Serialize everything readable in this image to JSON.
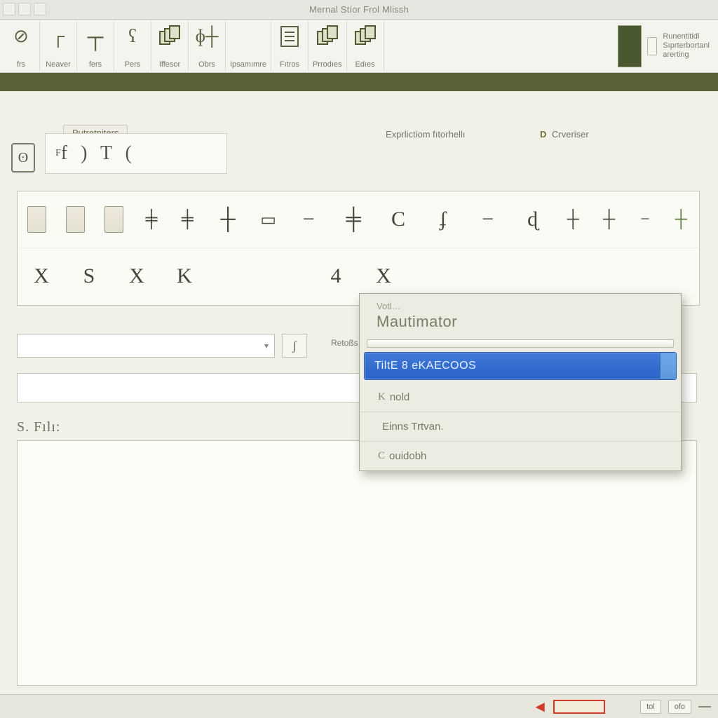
{
  "window": {
    "title": "Mernal Stíor Frol Mlissh"
  },
  "qat": [
    "qat-1",
    "qat-2",
    "qat-3"
  ],
  "ribbon": {
    "groups": [
      {
        "id": "frs",
        "label": "frs",
        "glyph": "⊘"
      },
      {
        "id": "neaver",
        "label": "Neaver",
        "glyph": "┌"
      },
      {
        "id": "fers",
        "label": "fers",
        "glyph": "┬"
      },
      {
        "id": "pes",
        "label": "Pers",
        "glyph": "ʕ"
      },
      {
        "id": "iffesor",
        "label": "Iffesor",
        "glyph": "stack"
      },
      {
        "id": "obrs",
        "label": "Obrs",
        "glyph": "ɸ┼"
      },
      {
        "id": "ipsam",
        "label": "Ipsamımre",
        "glyph": ""
      },
      {
        "id": "ftros",
        "label": "Fıtros",
        "glyph": "rect"
      },
      {
        "id": "prrodes",
        "label": "Prrodıes",
        "glyph": "stack"
      },
      {
        "id": "edes",
        "label": "Edıes",
        "glyph": "stack"
      }
    ],
    "tail": {
      "text": "Runentitidl\nSıprterbortanl\narerting"
    }
  },
  "workspace": {
    "tab_primary": "Putretniters",
    "link_a": "Exprlictiom fıtorhellı",
    "link_b_prefix": "D",
    "link_b": "Crveriser",
    "side_badge": "ʘ",
    "formula": "f ) T (",
    "formula_sup": "F",
    "gallery": {
      "row1_thumbs": 3,
      "row1_glyphs": [
        "╪",
        "╪",
        "┼",
        "▭",
        "−",
        "╪",
        "C",
        "ʄ",
        "−",
        "ɖ",
        "┼",
        "┼",
        "−",
        "┼"
      ],
      "row2_glyphs": [
        "X",
        "S",
        "X",
        "K",
        "4",
        "X"
      ]
    },
    "selector_value": "",
    "drop_extra_glyph": "ʃ",
    "drop_label": "Retoßs",
    "results_label": "S. Fılı:"
  },
  "context_menu": {
    "sub": "Votl…",
    "main": "Mautimator",
    "selected": "TiltE 8 eKAECOOS",
    "items": [
      {
        "key": "K",
        "label": "nold"
      },
      {
        "key": "",
        "label": "Einns Trtvan."
      },
      {
        "key": "C",
        "label": "ouidobh"
      }
    ]
  },
  "status": {
    "chips": [
      "tol",
      "ofo"
    ]
  }
}
